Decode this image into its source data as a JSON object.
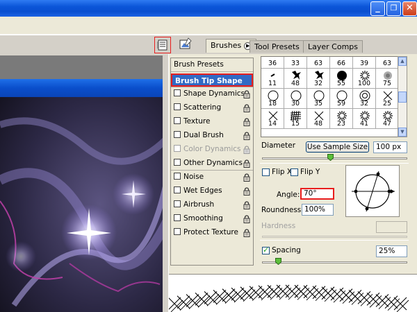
{
  "window": {
    "minimize_glyph": "_",
    "restore_glyph": "❐",
    "close_glyph": "✕"
  },
  "panel_tabs": [
    {
      "label": "Brushes"
    },
    {
      "label": "Tool Presets"
    },
    {
      "label": "Layer Comps"
    }
  ],
  "brush_settings": {
    "presets_label": "Brush Presets",
    "items": [
      {
        "label": "Brush Tip Shape",
        "checked": null,
        "locked": false,
        "enabled": true,
        "selected": true
      },
      {
        "label": "Shape Dynamics",
        "checked": false,
        "locked": true,
        "enabled": true
      },
      {
        "label": "Scattering",
        "checked": false,
        "locked": true,
        "enabled": true
      },
      {
        "label": "Texture",
        "checked": false,
        "locked": true,
        "enabled": true
      },
      {
        "label": "Dual Brush",
        "checked": false,
        "locked": true,
        "enabled": true
      },
      {
        "label": "Color Dynamics",
        "checked": false,
        "locked": true,
        "enabled": false
      },
      {
        "label": "Other Dynamics",
        "checked": false,
        "locked": true,
        "enabled": true
      },
      {
        "label": "Noise",
        "checked": false,
        "locked": true,
        "enabled": true
      },
      {
        "label": "Wet Edges",
        "checked": false,
        "locked": true,
        "enabled": true
      },
      {
        "label": "Airbrush",
        "checked": false,
        "locked": true,
        "enabled": true
      },
      {
        "label": "Smoothing",
        "checked": false,
        "locked": true,
        "enabled": true
      },
      {
        "label": "Protect Texture",
        "checked": false,
        "locked": true,
        "enabled": true
      }
    ]
  },
  "brush_grid": {
    "rows": [
      [
        {
          "size": "36",
          "shape": "tuft"
        },
        {
          "size": "33",
          "shape": "tuft"
        },
        {
          "size": "63",
          "shape": "tuft"
        },
        {
          "size": "66",
          "shape": "tuft"
        },
        {
          "size": "39",
          "shape": "tuft"
        },
        {
          "size": "63",
          "shape": "tuft"
        }
      ],
      [
        {
          "size": "11",
          "shape": "dash"
        },
        {
          "size": "48",
          "shape": "leaf"
        },
        {
          "size": "32",
          "shape": "leaf"
        },
        {
          "size": "55",
          "shape": "dot"
        },
        {
          "size": "100",
          "shape": "burst"
        },
        {
          "size": "75",
          "shape": "fuzz"
        }
      ],
      [
        {
          "size": "18",
          "shape": "circle"
        },
        {
          "size": "30",
          "shape": "circle"
        },
        {
          "size": "35",
          "shape": "circle"
        },
        {
          "size": "59",
          "shape": "circle"
        },
        {
          "size": "32",
          "shape": "ring"
        },
        {
          "size": "25",
          "shape": "cross"
        }
      ],
      [
        {
          "size": "14",
          "shape": "cross"
        },
        {
          "size": "15",
          "shape": "hatch"
        },
        {
          "size": "48",
          "shape": "cross"
        },
        {
          "size": "23",
          "shape": "burst"
        },
        {
          "size": "41",
          "shape": "burst"
        },
        {
          "size": "47",
          "shape": "burst"
        }
      ]
    ]
  },
  "tip_shape": {
    "diameter_label": "Diameter",
    "use_sample_size_label": "Use Sample Size",
    "diameter_value": "100 px",
    "diameter_slider_fraction": 0.47,
    "flip_x_label": "Flip X",
    "flip_y_label": "Flip Y",
    "flip_x": false,
    "flip_y": false,
    "angle_label": "Angle:",
    "angle_value": "70°",
    "roundness_label": "Roundness:",
    "roundness_value": "100%",
    "hardness_label": "Hardness",
    "hardness_value": "",
    "spacing_label": "Spacing",
    "spacing_checked": true,
    "spacing_value": "25%",
    "spacing_slider_fraction": 0.11
  },
  "colors": {
    "selection": "#316ac5",
    "highlight": "#e81d1d",
    "panel_bg": "#ece9d8"
  }
}
